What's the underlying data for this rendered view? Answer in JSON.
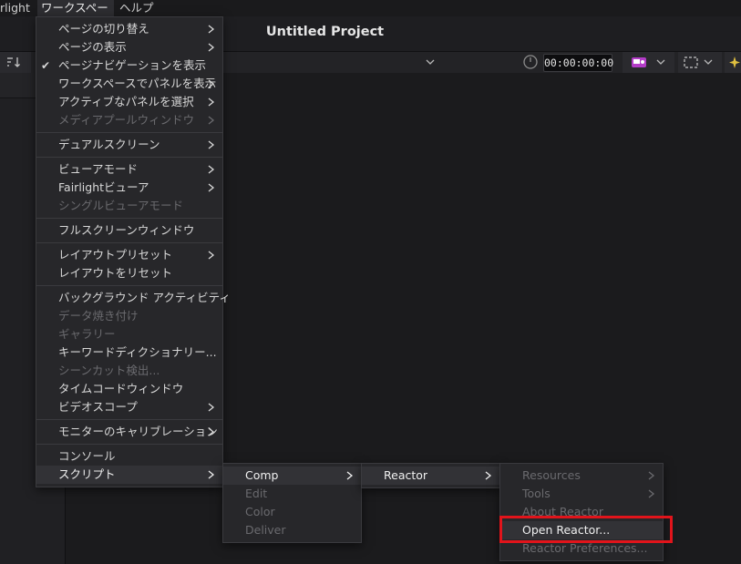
{
  "menubar": {
    "partial_item": "rlight",
    "workspace": "ワークスペース",
    "help": "ヘルプ"
  },
  "title": "Untitled Project",
  "toolbar": {
    "timecode": "00:00:00:00"
  },
  "workspace_menu": {
    "groups": [
      [
        {
          "label": "ページの切り替え",
          "submenu": true,
          "disabled": false,
          "checked": false
        },
        {
          "label": "ページの表示",
          "submenu": true,
          "disabled": false,
          "checked": false
        },
        {
          "label": "ページナビゲーションを表示",
          "submenu": false,
          "disabled": false,
          "checked": true
        },
        {
          "label": "ワークスペースでパネルを表示",
          "submenu": true,
          "disabled": false,
          "checked": false
        },
        {
          "label": "アクティブなパネルを選択",
          "submenu": true,
          "disabled": false,
          "checked": false
        },
        {
          "label": "メディアプールウィンドウ",
          "submenu": true,
          "disabled": true,
          "checked": false
        }
      ],
      [
        {
          "label": "デュアルスクリーン",
          "submenu": true,
          "disabled": false,
          "checked": false
        }
      ],
      [
        {
          "label": "ビューアモード",
          "submenu": true,
          "disabled": false,
          "checked": false
        },
        {
          "label": "Fairlightビューア",
          "submenu": true,
          "disabled": false,
          "checked": false
        },
        {
          "label": "シングルビューアモード",
          "submenu": false,
          "disabled": true,
          "checked": false
        }
      ],
      [
        {
          "label": "フルスクリーンウィンドウ",
          "submenu": false,
          "disabled": false,
          "checked": false
        }
      ],
      [
        {
          "label": "レイアウトプリセット",
          "submenu": true,
          "disabled": false,
          "checked": false
        },
        {
          "label": "レイアウトをリセット",
          "submenu": false,
          "disabled": false,
          "checked": false
        }
      ],
      [
        {
          "label": "バックグラウンド アクティビティ",
          "submenu": false,
          "disabled": false,
          "checked": false
        },
        {
          "label": "データ焼き付け",
          "submenu": false,
          "disabled": true,
          "checked": false
        },
        {
          "label": "ギャラリー",
          "submenu": false,
          "disabled": true,
          "checked": false
        },
        {
          "label": "キーワードディクショナリー...",
          "submenu": false,
          "disabled": false,
          "checked": false
        },
        {
          "label": "シーンカット検出...",
          "submenu": false,
          "disabled": true,
          "checked": false
        },
        {
          "label": "タイムコードウィンドウ",
          "submenu": false,
          "disabled": false,
          "checked": false
        },
        {
          "label": "ビデオスコープ",
          "submenu": true,
          "disabled": false,
          "checked": false
        }
      ],
      [
        {
          "label": "モニターのキャリブレーション",
          "submenu": true,
          "disabled": false,
          "checked": false
        }
      ],
      [
        {
          "label": "コンソール",
          "submenu": false,
          "disabled": false,
          "checked": false
        },
        {
          "label": "スクリプト",
          "submenu": true,
          "disabled": false,
          "checked": false,
          "highlighted": true
        }
      ]
    ]
  },
  "script_submenu": {
    "items": [
      {
        "label": "Comp",
        "submenu": true,
        "disabled": false,
        "highlighted": true
      },
      {
        "label": "Edit",
        "submenu": false,
        "disabled": true
      },
      {
        "label": "Color",
        "submenu": false,
        "disabled": true
      },
      {
        "label": "Deliver",
        "submenu": false,
        "disabled": true
      }
    ]
  },
  "comp_submenu": {
    "items": [
      {
        "label": "Reactor",
        "submenu": true,
        "disabled": false,
        "highlighted": true
      }
    ]
  },
  "reactor_submenu": {
    "items": [
      {
        "label": "Resources",
        "submenu": true,
        "disabled": true
      },
      {
        "label": "Tools",
        "submenu": true,
        "disabled": true
      },
      {
        "label": "About Reactor",
        "submenu": false,
        "disabled": true
      },
      {
        "label": "Open Reactor...",
        "submenu": false,
        "disabled": false,
        "highlighted": true
      },
      {
        "label": "Reactor Preferences...",
        "submenu": false,
        "disabled": true
      }
    ]
  },
  "colors": {
    "highlight_box": "#e1141b",
    "menu_bg": "#27272a",
    "accent_icon": "#b43cc8"
  }
}
